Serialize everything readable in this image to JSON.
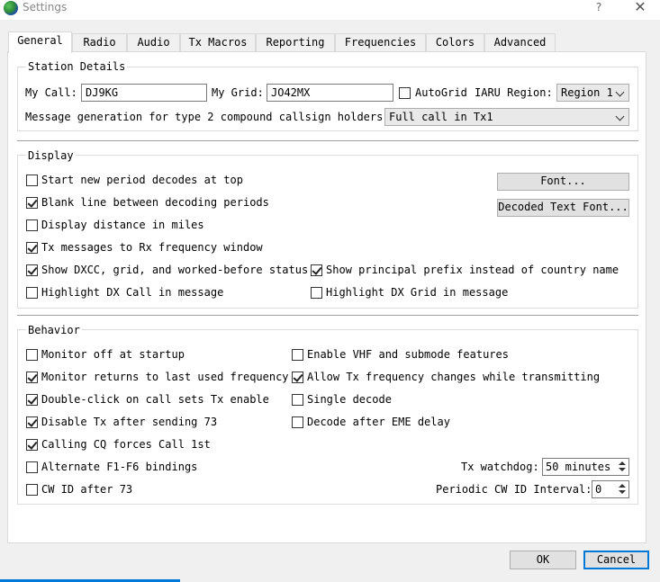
{
  "window": {
    "title": "Settings",
    "help_label": "?",
    "close_label": "✕"
  },
  "tabs": [
    {
      "label": "General",
      "active": true
    },
    {
      "label": "Radio"
    },
    {
      "label": "Audio"
    },
    {
      "label": "Tx Macros"
    },
    {
      "label": "Reporting"
    },
    {
      "label": "Frequencies"
    },
    {
      "label": "Colors"
    },
    {
      "label": "Advanced"
    }
  ],
  "station": {
    "group_title": "Station Details",
    "my_call_label": "My Call:",
    "my_call_value": "DJ9KG",
    "my_grid_label": "My Grid:",
    "my_grid_value": "JO42MX",
    "autogrid_label": "AutoGrid",
    "iaru_label": "IARU Region:",
    "iaru_value": "Region 1",
    "msg_gen_label": "Message generation for type 2 compound callsign holders:",
    "msg_gen_value": "Full call in Tx1"
  },
  "display": {
    "group_title": "Display",
    "items": [
      {
        "label": "Start new period decodes at top",
        "checked": false
      },
      {
        "label": "Blank line between decoding periods",
        "checked": true
      },
      {
        "label": "Display distance in miles",
        "checked": false
      },
      {
        "label": "Tx messages to Rx frequency window",
        "checked": true
      },
      {
        "label": "Show DXCC, grid, and worked-before status",
        "checked": true
      },
      {
        "label": "Show principal prefix instead of country name",
        "checked": true
      },
      {
        "label": "Highlight DX Call in message",
        "checked": false
      },
      {
        "label": "Highlight DX Grid in message",
        "checked": false
      }
    ],
    "font_button": "Font...",
    "decoded_font_button": "Decoded Text Font..."
  },
  "behavior": {
    "group_title": "Behavior",
    "items": [
      {
        "label": "Monitor off at startup",
        "checked": false
      },
      {
        "label": "Monitor returns to last used frequency",
        "checked": true
      },
      {
        "label": "Double-click on call sets Tx enable",
        "checked": true
      },
      {
        "label": "Disable Tx after sending 73",
        "checked": true
      },
      {
        "label": "Calling CQ forces Call 1st",
        "checked": true
      },
      {
        "label": "Alternate F1-F6 bindings",
        "checked": false
      },
      {
        "label": "CW ID after 73",
        "checked": false
      },
      {
        "label": "Enable VHF and submode features",
        "checked": false
      },
      {
        "label": "Allow Tx frequency changes while transmitting",
        "checked": true
      },
      {
        "label": "Single decode",
        "checked": false
      },
      {
        "label": "Decode after EME delay",
        "checked": false
      }
    ],
    "tx_watchdog_label": "Tx watchdog:",
    "tx_watchdog_value": "50 minutes",
    "cw_id_interval_label": "Periodic CW ID Interval:",
    "cw_id_interval_value": "0"
  },
  "dialog": {
    "ok_label": "OK",
    "cancel_label": "Cancel"
  }
}
